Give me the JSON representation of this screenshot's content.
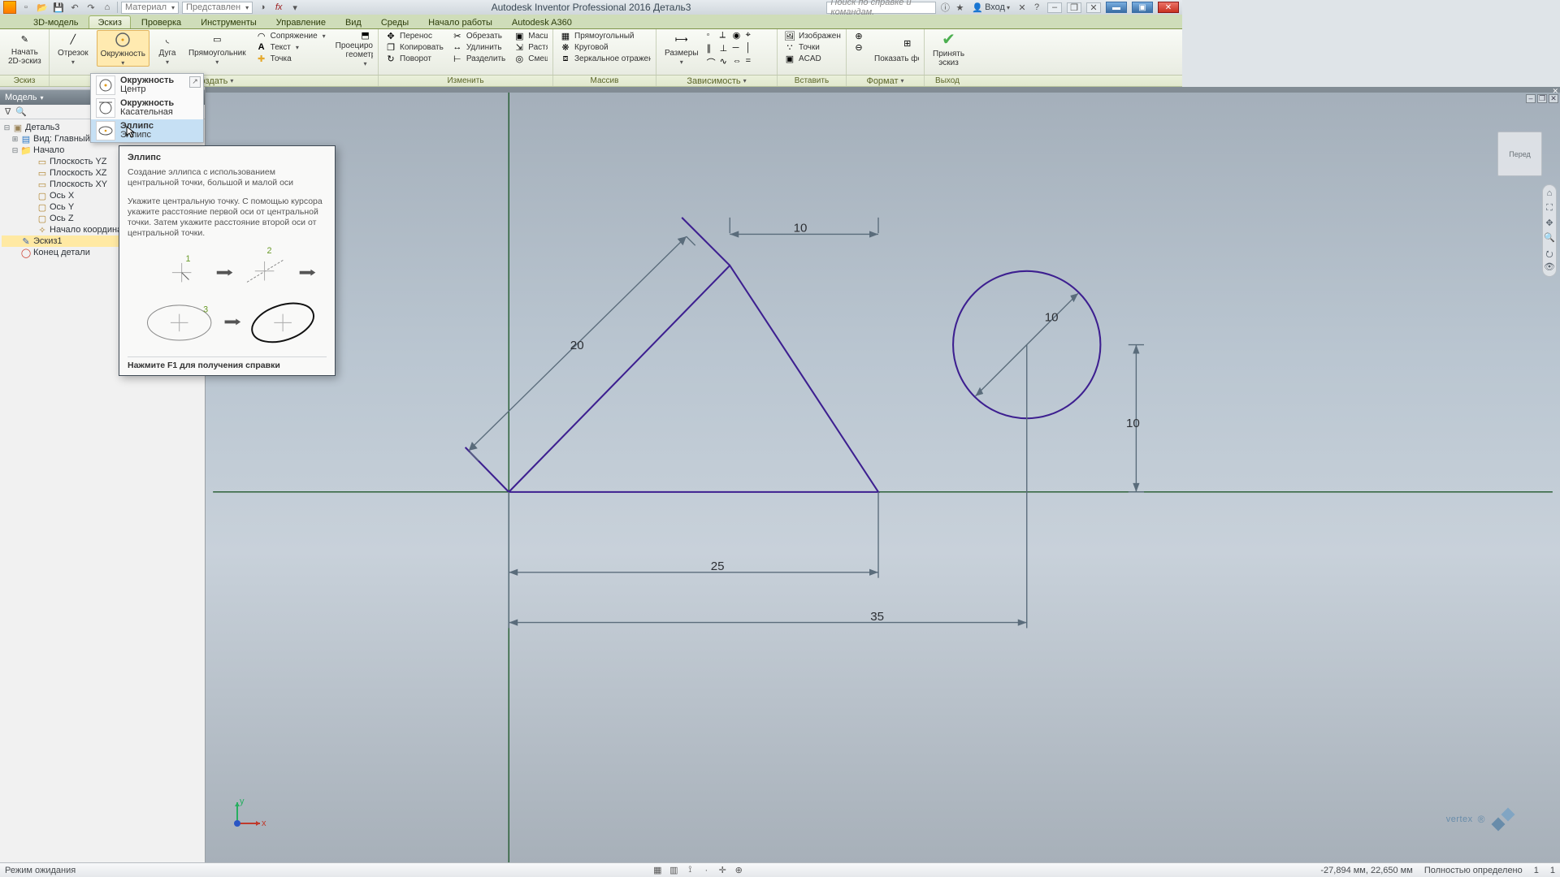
{
  "app_title": "Autodesk Inventor Professional 2016   Деталь3",
  "qat": {
    "material_ph": "Материал",
    "appearance_ph": "Представлен"
  },
  "search_ph": "Поиск по справке и командам.",
  "login_label": "Вход",
  "ribbon_tabs": [
    "3D-модель",
    "Эскиз",
    "Проверка",
    "Инструменты",
    "Управление",
    "Вид",
    "Среды",
    "Начало работы",
    "Autodesk A360"
  ],
  "ribbon_active_index": 1,
  "ribbon": {
    "sketch_panel": "Эскиз",
    "sketch_start": "Начать\n2D-эскиз",
    "line": "Отрезок",
    "circle": "Окружность",
    "arc": "Дуга",
    "rectangle": "Прямоугольник",
    "spline": "Сопряжение",
    "text": "Текст",
    "point": "Точка",
    "create_panel": "Создать",
    "project_geometry": "Проецирование\nгеометрии",
    "move": "Перенос",
    "copy": "Копировать",
    "rotate": "Поворот",
    "trim": "Обрезать",
    "extend": "Удлинить",
    "split": "Разделить",
    "scale": "Масштаб",
    "stretch": "Растянуть",
    "offset": "Смещение",
    "modify_panel": "Изменить",
    "rect_pattern": "Прямоугольный",
    "circ_pattern": "Круговой",
    "mirror": "Зеркальное отражение",
    "pattern_panel": "Массив",
    "dimension": "Размеры",
    "constrain_panel": "Зависимость",
    "image": "Изображение",
    "points": "Точки",
    "acad": "ACAD",
    "insert_panel": "Вставить",
    "show_format": "Показать формат",
    "format_panel": "Формат",
    "finish_sketch": "Принять\nэскиз",
    "finish_panel": "Выход"
  },
  "circle_options": [
    {
      "name": "Окружность",
      "sub": "Центр"
    },
    {
      "name": "Окружность",
      "sub": "Касательная"
    },
    {
      "name": "Эллипс",
      "sub": "Эллипс"
    }
  ],
  "tooltip": {
    "title": "Эллипс",
    "p1": "Создание эллипса с использованием центральной точки, большой и малой оси",
    "p2": "Укажите центральную точку. С помощью курсора укажите расстояние первой оси от центральной точки. Затем укажите расстояние второй оси от центральной точки.",
    "footer": "Нажмите F1 для получения справки"
  },
  "model_panel": {
    "title": "Модель",
    "root": "Деталь3",
    "view": "Вид: Главный",
    "origin": "Начало",
    "planes": [
      "Плоскость YZ",
      "Плоскость XZ",
      "Плоскость XY"
    ],
    "axes": [
      "Ось X",
      "Ось Y",
      "Ось Z"
    ],
    "origin_pt": "Начало координат",
    "sketch1": "Эскиз1",
    "end": "Конец детали"
  },
  "dimensions": {
    "diag": "20",
    "top": "10",
    "circle_d": "10",
    "right_h": "10",
    "base": "25",
    "full": "35"
  },
  "viewcube": "Перед",
  "status": {
    "mode": "Режим ожидания",
    "coords": "-27,894 мм, 22,650 мм",
    "defined": "Полностью определено",
    "n1": "1",
    "n2": "1"
  },
  "watermark_text": "vertex"
}
